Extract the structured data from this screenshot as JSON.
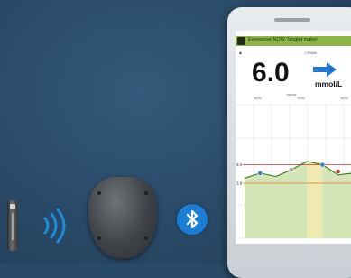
{
  "app": {
    "topbar_title": "Eversense NOW  Tanglet maker",
    "time_label": "7:00AM",
    "glucose_value": "6.0",
    "glucose_unit": "mmol/L",
    "trend": "up-right",
    "range_label": "Yellow",
    "axis_labels": [
      "1600",
      "1000",
      "1600"
    ],
    "y_marks": [
      "6.0",
      "3.9"
    ],
    "colors": {
      "topbar": "#8fb54a",
      "trend_arrow": "#1f77d4",
      "target_band": "#cfe3b0",
      "highlight_band": "#f3eab0",
      "line": "#4a7c2e",
      "high_threshold": "#c0392b",
      "low_threshold": "#d98b2b"
    }
  },
  "devices": {
    "sensor_icon": "sensor-transmitter-icon",
    "signal_icon": "wireless-signal-icon",
    "receiver_icon": "smart-transmitter-icon",
    "bluetooth_icon": "bluetooth-icon"
  },
  "chart_data": {
    "type": "line",
    "x": [
      0,
      1,
      2,
      3,
      4,
      5,
      6,
      7
    ],
    "series": [
      {
        "values": [
          3.6,
          3.9,
          3.7,
          4.1,
          4.6,
          4.4,
          3.8,
          3.9
        ]
      }
    ],
    "markers": [
      {
        "x": 1,
        "y": 3.9,
        "color": "#3a7fc4"
      },
      {
        "x": 3,
        "y": 4.1,
        "color": "#9aa7a0"
      },
      {
        "x": 5,
        "y": 4.4,
        "color": "#3a7fc4"
      },
      {
        "x": 6,
        "y": 4.0,
        "color": "#c0392b"
      }
    ],
    "ylim": [
      0,
      8
    ],
    "grid": true
  }
}
